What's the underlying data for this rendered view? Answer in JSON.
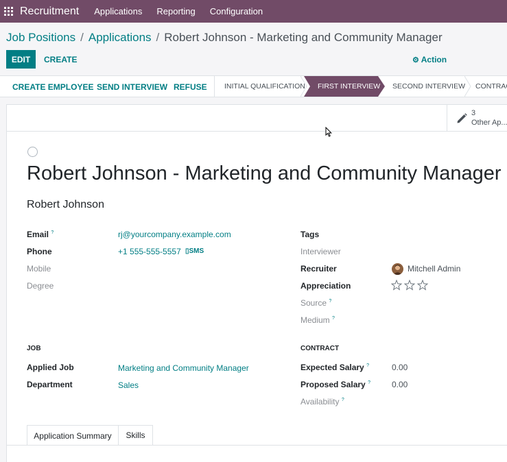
{
  "navbar": {
    "app": "Recruitment",
    "menus": [
      "Applications",
      "Reporting",
      "Configuration"
    ]
  },
  "breadcrumb": {
    "items": [
      "Job Positions",
      "Applications",
      "Robert Johnson - Marketing and Community Manager"
    ]
  },
  "control": {
    "edit_label": "EDIT",
    "create_label": "CREATE",
    "action_label": "Action"
  },
  "statusbar": {
    "buttons": [
      "CREATE EMPLOYEE",
      "SEND INTERVIEW",
      "REFUSE"
    ],
    "stages": [
      "INITIAL QUALIFICATION",
      "FIRST INTERVIEW",
      "SECOND INTERVIEW",
      "CONTRACT"
    ],
    "active_stage": "FIRST INTERVIEW"
  },
  "smart_button": {
    "count": "3",
    "label": "Other Ap..."
  },
  "record": {
    "title": "Robert Johnson - Marketing and Community Manager",
    "applicant_name": "Robert Johnson"
  },
  "fields_left": {
    "email_label": "Email",
    "email": "rj@yourcompany.example.com",
    "phone_label": "Phone",
    "phone": "+1 555-555-5557",
    "sms_label": "SMS",
    "mobile_label": "Mobile",
    "degree_label": "Degree"
  },
  "fields_right": {
    "tags_label": "Tags",
    "interviewer_label": "Interviewer",
    "recruiter_label": "Recruiter",
    "recruiter": "Mitchell Admin",
    "appreciation_label": "Appreciation",
    "appreciation_stars": 0,
    "appreciation_max": 3,
    "source_label": "Source",
    "medium_label": "Medium"
  },
  "job": {
    "section": "JOB",
    "applied_job_label": "Applied Job",
    "applied_job": "Marketing and Community Manager",
    "department_label": "Department",
    "department": "Sales"
  },
  "contract": {
    "section": "CONTRACT",
    "expected_salary_label": "Expected Salary",
    "expected_salary": "0.00",
    "proposed_salary_label": "Proposed Salary",
    "proposed_salary": "0.00",
    "availability_label": "Availability"
  },
  "tabs": [
    "Application Summary",
    "Skills"
  ],
  "colors": {
    "brand": "#714b67",
    "link": "#017e84"
  }
}
